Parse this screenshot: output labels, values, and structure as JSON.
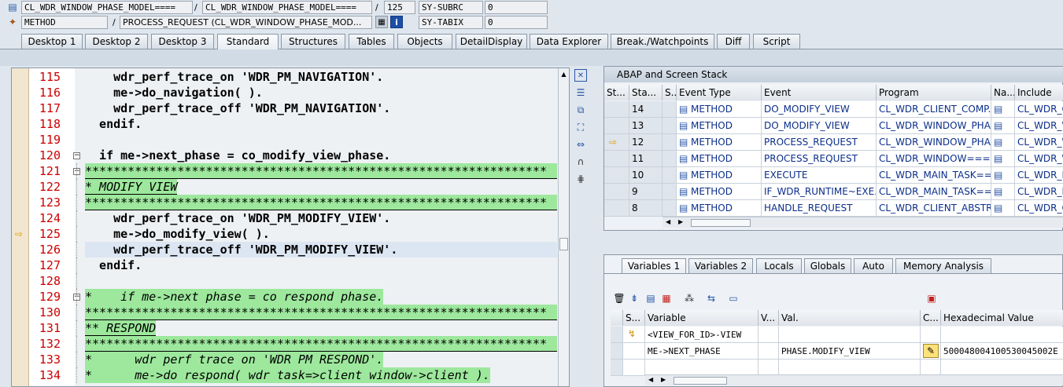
{
  "header": {
    "row1": {
      "class_field": "CL_WDR_WINDOW_PHASE_MODEL====",
      "sep1": "/",
      "include_field": "CL_WDR_WINDOW_PHASE_MODEL====",
      "sep2": "/",
      "line_field": "125",
      "sysvar": "SY-SUBRC",
      "value": "0"
    },
    "row2": {
      "type_field": "METHOD",
      "sep": "/",
      "method_field": "PROCESS_REQUEST (CL_WDR_WINDOW_PHASE_MOD...",
      "sysvar": "SY-TABIX",
      "value": "0"
    }
  },
  "main_tabs": [
    "Desktop 1",
    "Desktop 2",
    "Desktop 3",
    "Standard",
    "Structures",
    "Tables",
    "Objects",
    "DetailDisplay",
    "Data Explorer",
    "Break./Watchpoints",
    "Diff",
    "Script"
  ],
  "active_tab": "Standard",
  "editor": {
    "lines": [
      {
        "n": "115",
        "text": "    wdr_perf_trace_on 'WDR_PM_NAVIGATION'."
      },
      {
        "n": "116",
        "text": "    me->do_navigation( )."
      },
      {
        "n": "117",
        "text": "    wdr_perf_trace_off 'WDR_PM_NAVIGATION'."
      },
      {
        "n": "118",
        "text": "  endif."
      },
      {
        "n": "119",
        "text": ""
      },
      {
        "n": "120",
        "text": "  if me->next_phase = co_modify_view_phase."
      },
      {
        "n": "121",
        "text": "*****************************************************************"
      },
      {
        "n": "122",
        "text": "* MODIFY VIEW"
      },
      {
        "n": "123",
        "text": "*****************************************************************"
      },
      {
        "n": "124",
        "text": "    wdr_perf_trace_on 'WDR_PM_MODIFY_VIEW'."
      },
      {
        "n": "125",
        "text": "    me->do_modify_view( )."
      },
      {
        "n": "126",
        "text": "    wdr_perf_trace_off 'WDR_PM_MODIFY_VIEW'."
      },
      {
        "n": "127",
        "text": "  endif."
      },
      {
        "n": "128",
        "text": ""
      },
      {
        "n": "129",
        "text": "*    if me->next phase = co respond phase."
      },
      {
        "n": "130",
        "text": "*****************************************************************"
      },
      {
        "n": "131",
        "text": "** RESPOND"
      },
      {
        "n": "132",
        "text": "*****************************************************************"
      },
      {
        "n": "133",
        "text": "*      wdr perf trace on 'WDR PM RESPOND'."
      },
      {
        "n": "134",
        "text": "*      me->do respond( wdr task=>client window->client )."
      }
    ]
  },
  "stack": {
    "title": "ABAP and Screen Stack",
    "columns": [
      "St...",
      "Sta...",
      "S...",
      "Event Type",
      "Event",
      "Program",
      "Na...",
      "Include"
    ],
    "rows": [
      {
        "sta": "14",
        "type": "METHOD",
        "event": "DO_MODIFY_VIEW",
        "program": "CL_WDR_CLIENT_COMP...",
        "include": "CL_WDR_C"
      },
      {
        "sta": "13",
        "type": "METHOD",
        "event": "DO_MODIFY_VIEW",
        "program": "CL_WDR_WINDOW_PHA...",
        "include": "CL_WDR_W"
      },
      {
        "sta": "12",
        "type": "METHOD",
        "event": "PROCESS_REQUEST",
        "program": "CL_WDR_WINDOW_PHA...",
        "include": "CL_WDR_W"
      },
      {
        "sta": "11",
        "type": "METHOD",
        "event": "PROCESS_REQUEST",
        "program": "CL_WDR_WINDOW===...",
        "include": "CL_WDR_W"
      },
      {
        "sta": "10",
        "type": "METHOD",
        "event": "EXECUTE",
        "program": "CL_WDR_MAIN_TASK==...",
        "include": "CL_WDR_M"
      },
      {
        "sta": "9",
        "type": "METHOD",
        "event": "IF_WDR_RUNTIME~EXE...",
        "program": "CL_WDR_MAIN_TASK==...",
        "include": "CL_WDR_M"
      },
      {
        "sta": "8",
        "type": "METHOD",
        "event": "HANDLE_REQUEST",
        "program": "CL_WDR_CLIENT_ABSTR...",
        "include": "CL_WDR_C"
      }
    ]
  },
  "vars": {
    "tabs": [
      "Variables 1",
      "Variables 2",
      "Locals",
      "Globals",
      "Auto",
      "Memory Analysis"
    ],
    "columns": [
      "S...",
      "Variable",
      "V...",
      "Val.",
      "C...",
      "Hexadecimal Value"
    ],
    "rows": [
      {
        "variable": "<VIEW_FOR_ID>-VIEW",
        "val": "",
        "hex": ""
      },
      {
        "variable": "ME->NEXT_PHASE",
        "val": "PHASE.MODIFY_VIEW",
        "hex": "500048004100530045002E"
      },
      {
        "variable": "",
        "val": "",
        "hex": ""
      }
    ]
  },
  "colors": {
    "comment_bg": "#9de89d",
    "line_number": "#cc0000",
    "string": "#1414d2",
    "current_line_bg": "#dce6f2"
  }
}
